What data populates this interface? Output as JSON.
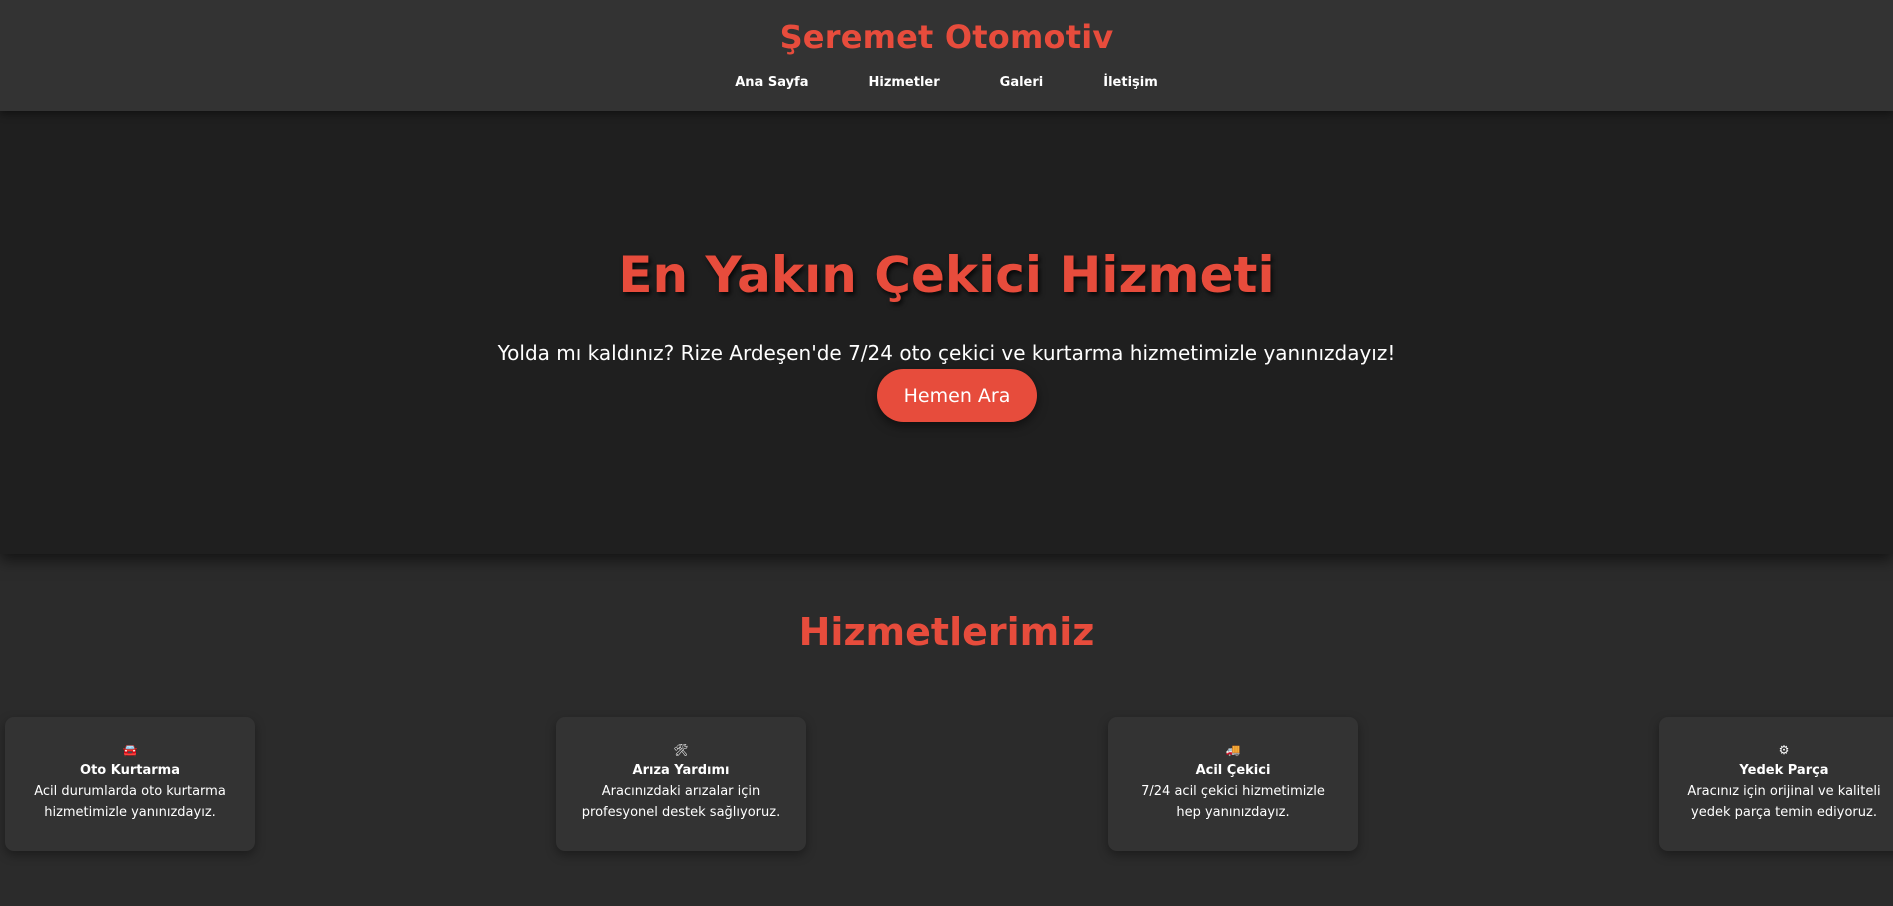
{
  "header": {
    "brand": "Şeremet Otomotiv",
    "nav": [
      "Ana Sayfa",
      "Hizmetler",
      "Galeri",
      "İletişim"
    ]
  },
  "hero": {
    "title": "En Yakın Çekici Hizmeti",
    "subtitle": "Yolda mı kaldınız? Rize Ardeşen'de 7/24 oto çekici ve kurtarma hizmetimizle yanınızdayız!",
    "button": "Hemen Ara"
  },
  "services": {
    "title": "Hizmetlerimiz",
    "cards": [
      {
        "icon": "tow-car-icon",
        "glyph": "🚘",
        "title": "Oto Kurtarma",
        "desc": "Acil durumlarda oto kurtarma hizmetimizle yanınızdayız."
      },
      {
        "icon": "tools-icon",
        "glyph": "🛠",
        "title": "Arıza Yardımı",
        "desc": "Aracınızdaki arızalar için profesyonel destek sağlıyoruz."
      },
      {
        "icon": "truck-icon",
        "glyph": "🚚",
        "title": "Acil Çekici",
        "desc": "7/24 acil çekici hizmetimizle hep yanınızdayız."
      },
      {
        "icon": "gears-icon",
        "glyph": "⚙",
        "title": "Yedek Parça",
        "desc": "Aracınız için orijinal ve kaliteli yedek parça temin ediyoruz."
      }
    ]
  },
  "colors": {
    "accent": "#e74c3c",
    "header_bg": "#333333",
    "hero_bg": "#1f1f1f",
    "page_bg": "#2b2b2b",
    "card_bg": "#333333"
  }
}
